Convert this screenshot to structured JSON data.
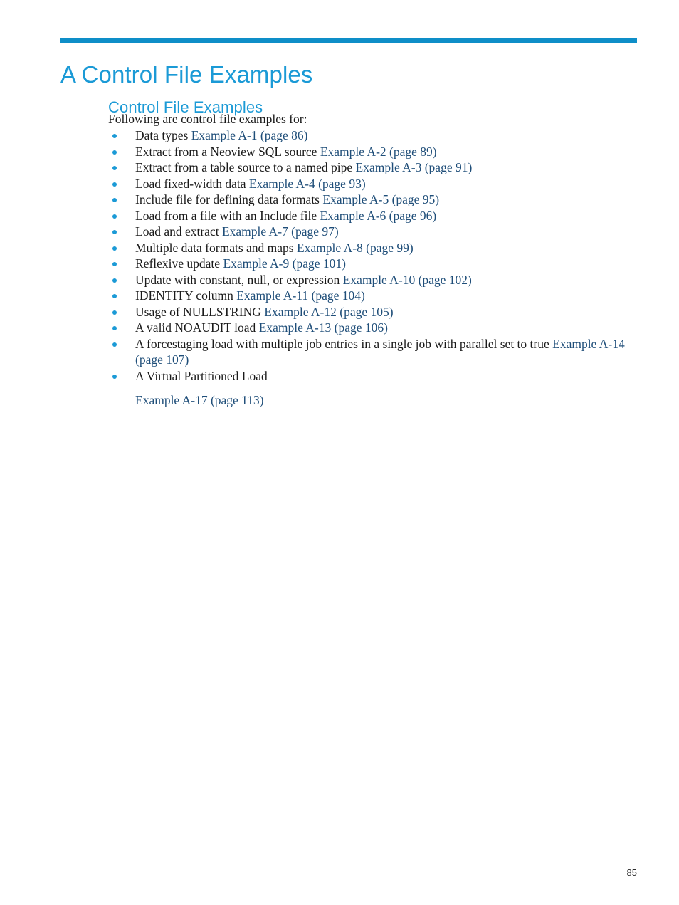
{
  "document": {
    "chapter_label": "A Control File Examples",
    "section_title": "Control File Examples",
    "intro": "Following are control file examples for:",
    "page_number": "85"
  },
  "colors": {
    "rule": "#0e8ec8",
    "heading": "#1b9ad6",
    "bullet": "#1b9ad6",
    "crossref": "#1f4e79",
    "body_text": "#1a1a1a"
  },
  "bullets": [
    {
      "text": "Data types ",
      "xref": "Example A-1 (page 86)"
    },
    {
      "text": "Extract from a Neoview SQL source ",
      "xref": "Example A-2 (page 89)"
    },
    {
      "text": "Extract from a table source to a named pipe ",
      "xref": "Example A-3 (page 91)"
    },
    {
      "text": "Load fixed-width data ",
      "xref": "Example A-4 (page 93)"
    },
    {
      "text": "Include file for defining data formats ",
      "xref": "Example A-5 (page 95)"
    },
    {
      "text": "Load from a file with an Include file ",
      "xref": "Example A-6 (page 96)"
    },
    {
      "text": "Load and extract ",
      "xref": "Example A-7 (page 97)"
    },
    {
      "text": "Multiple data formats and maps ",
      "xref": "Example A-8 (page 99)"
    },
    {
      "text": "Reflexive update ",
      "xref": "Example A-9 (page 101)"
    },
    {
      "text": "Update with constant, null, or expression ",
      "xref": "Example A-10 (page 102)"
    },
    {
      "text": "IDENTITY column ",
      "xref": "Example A-11 (page 104)"
    },
    {
      "text": "Usage of NULLSTRING ",
      "xref": "Example A-12 (page 105)"
    },
    {
      "text": "A valid NOAUDIT load ",
      "xref": "Example A-13 (page 106)"
    },
    {
      "text": "A forcestaging load with multiple job entries in a single job with parallel set to true ",
      "xref": "Example A-14 (page 107)"
    },
    {
      "text": "A Virtual Partitioned Load",
      "xref": "Example A-17 (page 113)",
      "xref_separate_paragraph": true
    }
  ]
}
